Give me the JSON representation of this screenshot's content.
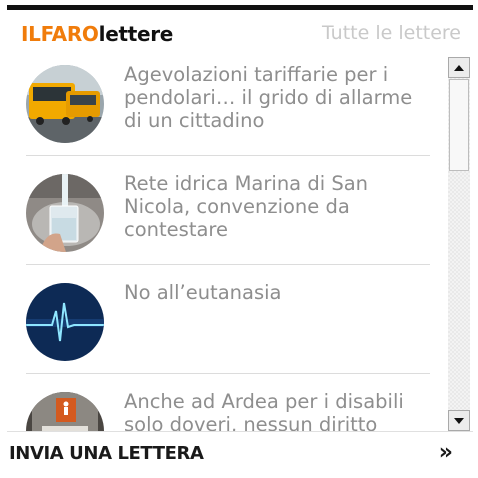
{
  "header": {
    "brand_part1": "ILFARO",
    "brand_part2": "lettere",
    "all_letters_link": "Tutte le lettere"
  },
  "letters": [
    {
      "title": "Agevolazioni tariffarie per i pendolari… il grido di allarme di un cittadino",
      "thumbnail": "bus-photo"
    },
    {
      "title": "Rete idrica Marina di San Nicola, convenzione da contestare",
      "thumbnail": "water-glass-photo"
    },
    {
      "title": "No all’eutanasia",
      "thumbnail": "heartbeat-photo"
    },
    {
      "title": "Anche ad Ardea per i disabili solo doveri, nessun diritto",
      "thumbnail": "disabled-sign-photo"
    }
  ],
  "footer": {
    "send_letter": "INVIA UNA LETTERA",
    "chevron": "»"
  },
  "colors": {
    "brand_orange": "#f07c0b",
    "title_gray": "#8e8e8e",
    "link_gray": "#c9c9c9",
    "top_bar": "#111111"
  },
  "icons": [
    "scroll-up-arrow-icon",
    "scroll-down-arrow-icon",
    "double-chevron-right-icon"
  ]
}
